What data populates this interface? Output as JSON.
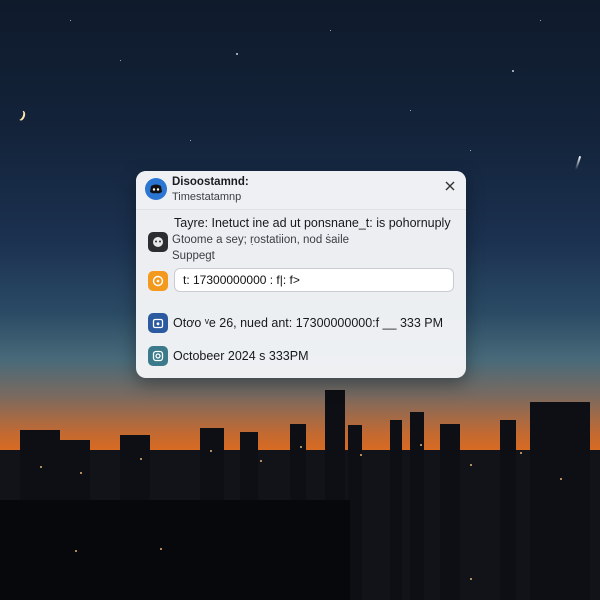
{
  "notification": {
    "app_name": "Disoostamnd:",
    "app_subtitle": "Timestatamnp",
    "message_line1": "Tayre: Inetuct ine ad ut ponsnane_t: is pohornuply",
    "message_line2": "Gtoome a sey; ṛostatiion, nod ṡaile",
    "message_line3": "Suppegt",
    "timestamp_input_value": "t: 17300000000 : f|: f>",
    "date_line_1": "Otơo ᵛe 26, nued ant: 17300000000:f __ 333 PM",
    "date_line_2": "Octobeer 2024 s 333PM"
  },
  "icons": {
    "app": "discord-icon",
    "close": "close-icon",
    "row1": "bot-icon",
    "row2": "clock-icon",
    "row3": "calendar-icon",
    "row4": "camera-icon"
  },
  "colors": {
    "app_icon": "#2a76d2",
    "row1_icon": "#2b2d31",
    "row2_icon": "#f39a1e",
    "row3_icon": "#2c5aa0",
    "row4_icon": "#3a7a8a"
  }
}
